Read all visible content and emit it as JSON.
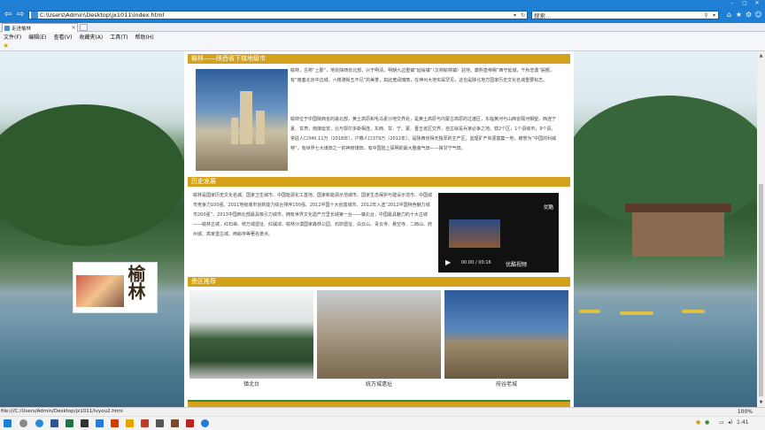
{
  "browser": {
    "address_url": "C:\\Users\\Admin\\Desktop\\jx1011\\index.html",
    "search_placeholder": "搜索...",
    "tab_title": "走进榆林",
    "menu": [
      "文件(F)",
      "编辑(E)",
      "查看(V)",
      "收藏夹(A)",
      "工具(T)",
      "帮助(H)"
    ],
    "status_url": "file:///C:/Users/Admin/Desktop/jx1011/lvyou2.html",
    "zoom": "100%"
  },
  "page": {
    "section1": {
      "title": "榆林——陕西省下辖地级市",
      "para1": "榆林，古称“上郡”，地处陕西省北部，兴于明清，明朝九边重镇“延绥镇”（又称榆林镇）驻地，康熙皇帝赐“西守延城，千秋忠勇”匾额，有“南塞北京中边城，六楼骑街五不见”的美誉，如此宽阔瑰丽，在神州大地实属罕见，这也是陕北地方国家历史文化名城重要标志。",
      "para2": "榆林位于中国陕西省的最北部，黄土高原和毛乌素沙地交界处，是黄土高原与内蒙古高原的过渡区，东临黄河与山西省隔河相望，西连宁夏、甘肃，南接延安，北与鄂尔多斯相连，东西、甘、宁、蒙、晋五省区交界，自古就是兵家必争之地。辖2个区，1个县级市，9个县，常驻人口340.11万（2018年），户籍人口379万（2012年），是陕西省得天独厚的主产区，监理矿产资源富集一地，被誉为“中国的科威特”，有世界七大煤田之一的神府煤田，有中国陆上探明的最大整装气田——陕甘宁气田。"
    },
    "section2": {
      "title": "历史发展",
      "para": "榆林是国家历史文化名城、国家卫生城市、中国能源化工基地、国家新能源示范城市、国家生态保护与建设示范市、中国城市竞争力100强、2011地级城市创新能力综合排序100强、2012中国十大创富城市、2012年入选“2012中国特色魅力城市200强”、2013中国西北部最具吸引力城市，拥有世界文化遗产万里长城第一台——镇北台，中国最具魅力的十大古城——榆林古城，红石峡、统万城遗址、红碱淖、榆林沙漠国家森林公园、石峁遗址、白云山、青云寺、悬空寺、二郎山、府州城、高家堡古城、西峪寺等著名景点。",
      "video": {
        "title_cn": "优酷",
        "time": "00:00 / 00:16",
        "brand": "优酷视频"
      }
    },
    "section3": {
      "title": "景区推荐",
      "scenes": [
        {
          "caption": "镇北台"
        },
        {
          "caption": "统万城遗址"
        },
        {
          "caption": "府谷老城"
        }
      ]
    },
    "floating_logo": "榆林",
    "colors": {
      "accent": "#d4a21a",
      "browser_blue": "#1e7fd4"
    }
  },
  "taskbar": {
    "time": "1:41",
    "icons": [
      "start-icon",
      "search-icon",
      "edge-icon",
      "word-icon",
      "excel-icon",
      "powerpoint-icon",
      "folder-icon",
      "ie-icon"
    ]
  }
}
